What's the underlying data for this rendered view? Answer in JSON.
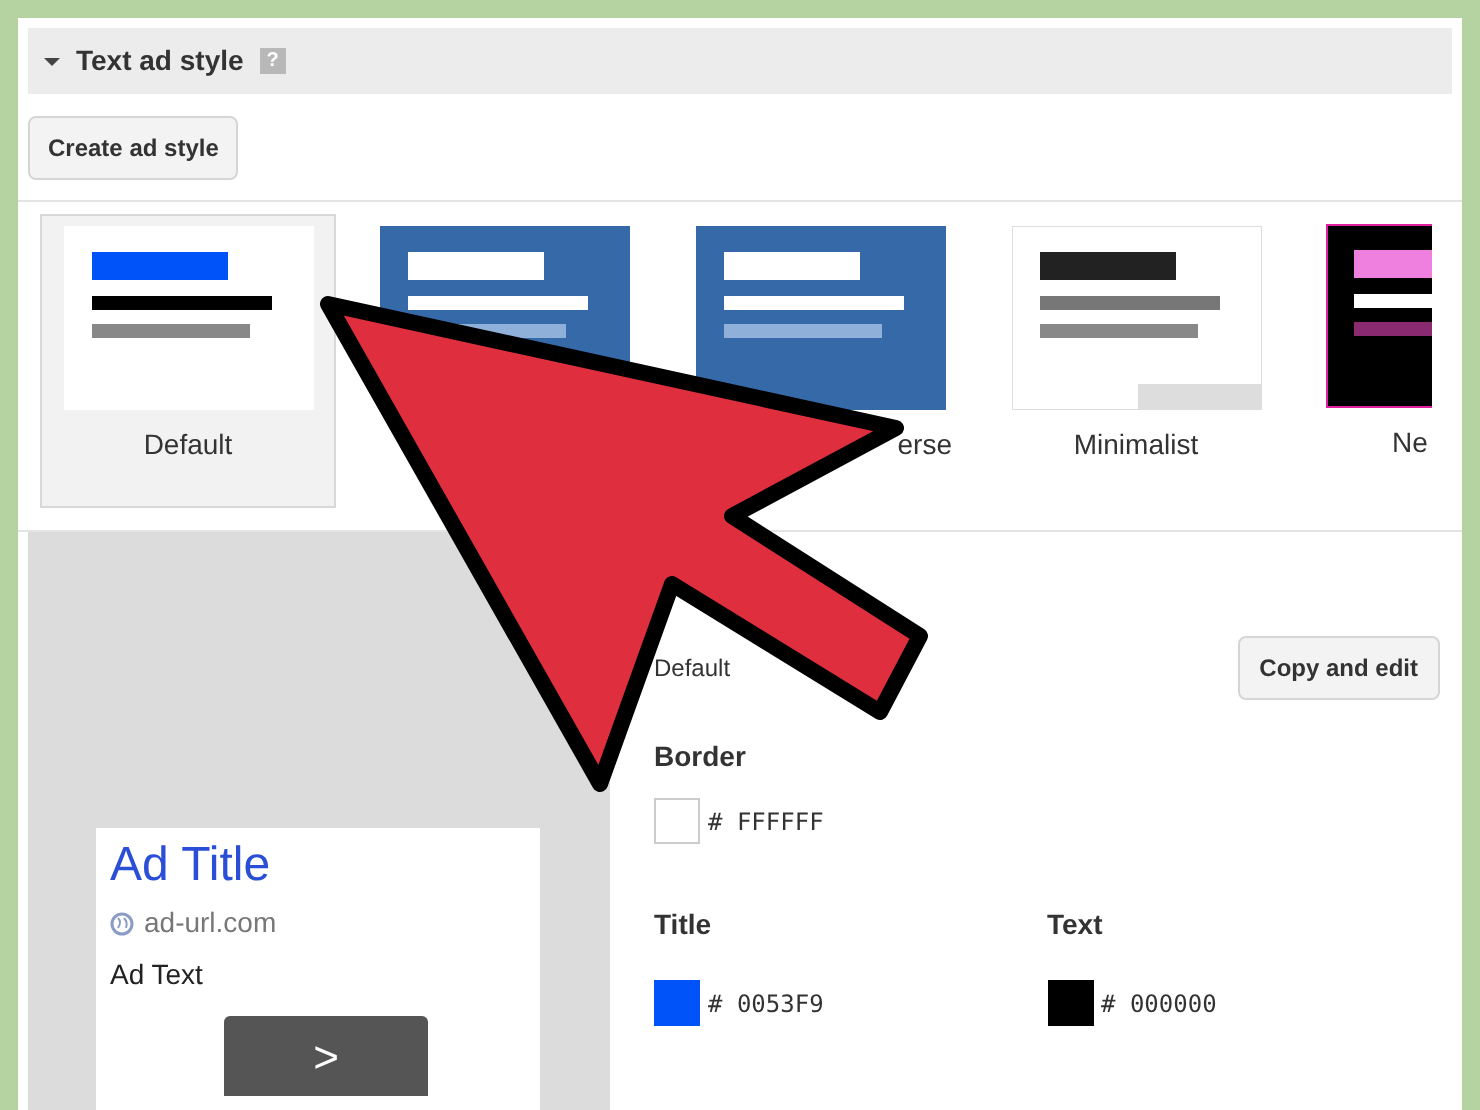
{
  "section": {
    "title": "Text ad style",
    "expanded": true,
    "help": "?"
  },
  "create_button": "Create ad style",
  "styles": [
    {
      "kind": "default",
      "label": "Default",
      "selected": true
    },
    {
      "kind": "blue",
      "selected": false
    },
    {
      "kind": "inverse",
      "label": "erse",
      "selected": false
    },
    {
      "kind": "minimalist",
      "label": "Minimalist",
      "selected": false
    },
    {
      "kind": "neon",
      "label": "Ne",
      "selected": false
    }
  ],
  "preview": {
    "title": "Ad Title",
    "url": "ad-url.com",
    "text": "Ad Text",
    "button": ">"
  },
  "details": {
    "style_name": "Default",
    "copy_button": "Copy and edit",
    "border": {
      "label": "Border",
      "value": "# FFFFFF",
      "color": "#ffffff"
    },
    "colors": [
      {
        "label": "Title",
        "value": "# 0053F9",
        "color": "#0053f9"
      },
      {
        "label": "Text",
        "value": "# 000000",
        "color": "#000000"
      }
    ]
  }
}
